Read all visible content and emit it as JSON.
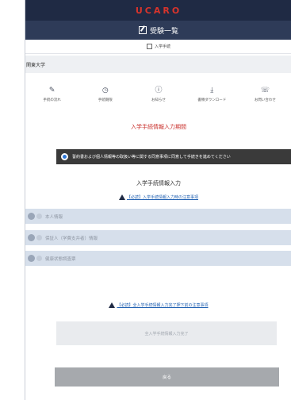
{
  "brand": "UCARO",
  "page_title": "受験一覧",
  "sub_nav": "入学手続",
  "school_name": "関東大学",
  "menu": [
    {
      "label": "手続の流れ",
      "icon": "pencil-icon",
      "glyph": "✎"
    },
    {
      "label": "手続期限",
      "icon": "clock-icon",
      "glyph": "◷"
    },
    {
      "label": "お知らせ",
      "icon": "info-icon",
      "glyph": "ⓘ"
    },
    {
      "label": "書類ダウンロード",
      "icon": "download-icon",
      "glyph": "⤓"
    },
    {
      "label": "お問い合わせ",
      "icon": "phone-icon",
      "glyph": "☏"
    }
  ],
  "period_title": "入学手続情報入力期間",
  "consent_text": "誓約書および個人情報等の取扱い等に関する同意事項に同意して手続きを進めてください",
  "consent_arrow": "›",
  "section_title": "入学手続情報入力",
  "notice_top": "【必読】入学手続情報入力時の注意事項",
  "accordion": [
    {
      "label": "本人情報"
    },
    {
      "label": "保証人（学費支弁者）情報"
    },
    {
      "label": "健康状態調査票"
    }
  ],
  "notice_bottom": "【必読】全入学手続情報入力完了押下前の注意事項",
  "complete_button": "全入学手続情報入力完了",
  "back_button": "戻る",
  "colors": {
    "brand_bar": "#1f2a44",
    "title_bar": "#2e3b58",
    "period_red": "#c9302c",
    "link_blue": "#2463b3",
    "accordion_bg": "#d6dfeb"
  }
}
